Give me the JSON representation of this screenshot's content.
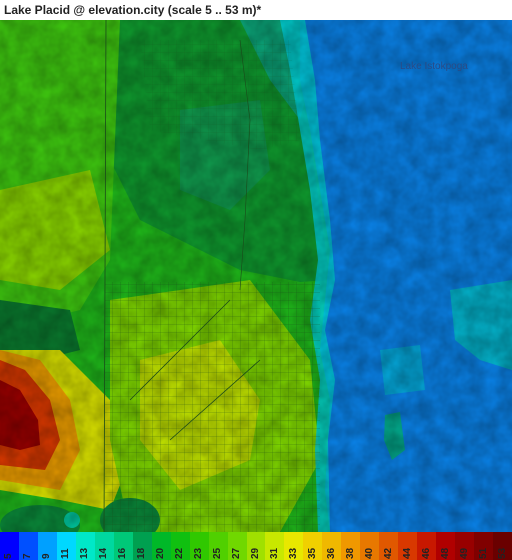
{
  "header": {
    "title": "Lake Placid @ elevation.city (scale 5 .. 53 m)*"
  },
  "map": {
    "labels": {
      "lake": "Lake Istokpoga"
    }
  },
  "legend": {
    "ticks": [
      "5",
      "7",
      "9",
      "11",
      "13",
      "14",
      "16",
      "18",
      "20",
      "22",
      "23",
      "25",
      "27",
      "29",
      "31",
      "33",
      "35",
      "36",
      "38",
      "40",
      "42",
      "44",
      "46",
      "48",
      "49",
      "51",
      "53"
    ],
    "colors": [
      "#0000ff",
      "#0050ff",
      "#00a0ff",
      "#00d8ff",
      "#00e8c8",
      "#00d8a0",
      "#00c878",
      "#00a050",
      "#00b828",
      "#10c010",
      "#30c800",
      "#50d000",
      "#70d800",
      "#a0e000",
      "#c8e800",
      "#e8e800",
      "#f0d000",
      "#f0b800",
      "#f09800",
      "#e87800",
      "#e05800",
      "#d83800",
      "#c81800",
      "#b00000",
      "#980000",
      "#800000",
      "#6a0000"
    ]
  }
}
